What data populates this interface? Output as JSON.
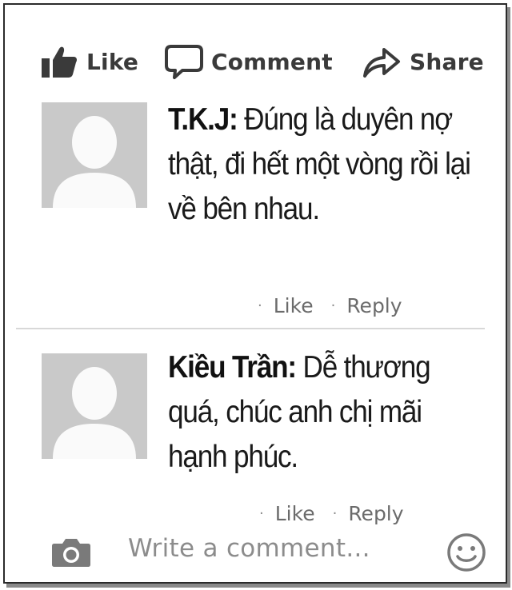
{
  "actions": {
    "like": {
      "label": "Like",
      "icon": "thumbs-up-icon"
    },
    "comment": {
      "label": "Comment",
      "icon": "speech-bubble-icon"
    },
    "share": {
      "label": "Share",
      "icon": "share-arrow-icon"
    }
  },
  "comments": [
    {
      "author": "T.K.J:",
      "text": " Đúng là duyên nợ thật, đi hết một vòng rồi lại về bên nhau.",
      "like_label": "Like",
      "reply_label": "Reply"
    },
    {
      "author": "Kiều Trần:",
      "text": " Dễ thương quá, chúc anh chị mãi hạnh phúc.",
      "like_label": "Like",
      "reply_label": "Reply"
    }
  ],
  "composer": {
    "placeholder": "Write a comment...",
    "camera_icon": "camera-icon",
    "emoji_icon": "smiley-icon"
  },
  "colors": {
    "text": "#1a1a1a",
    "muted": "#6b6b6b",
    "avatar_bg": "#c9c9c9",
    "avatar_fg": "#ffffff"
  }
}
